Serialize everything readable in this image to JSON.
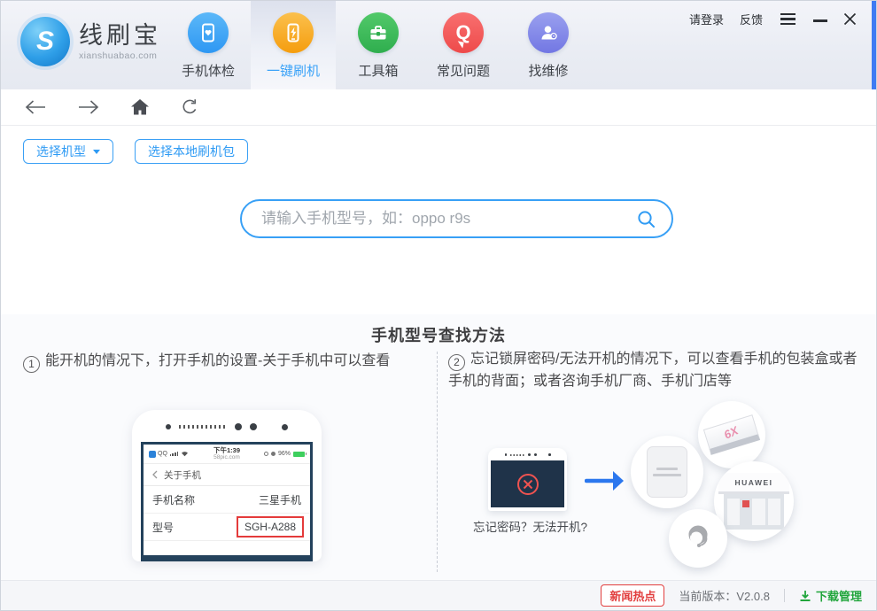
{
  "app": {
    "name": "线刷宝",
    "domain": "xianshuabao.com",
    "logo_letter": "S"
  },
  "header": {
    "login_label": "请登录",
    "feedback_label": "反馈",
    "nav": [
      {
        "label": "手机体检",
        "icon": "phone-checkup-icon",
        "color": "#2e97f3",
        "active": false
      },
      {
        "label": "一键刷机",
        "icon": "phone-flash-icon",
        "color": "#f59d0e",
        "active": true
      },
      {
        "label": "工具箱",
        "icon": "toolbox-icon",
        "color": "#2fae4e",
        "active": false
      },
      {
        "label": "常见问题",
        "icon": "faq-icon",
        "color": "#ee4a4a",
        "active": false,
        "glyph": "Q"
      },
      {
        "label": "找维修",
        "icon": "repair-icon",
        "color": "#7277e3",
        "active": false
      }
    ]
  },
  "actions": {
    "select_model": "选择机型",
    "select_local_package": "选择本地刷机包"
  },
  "search": {
    "placeholder": "请输入手机型号，如：oppo r9s"
  },
  "guide": {
    "title": "手机型号查找方法",
    "steps": [
      {
        "num": "1",
        "text": "能开机的情况下，打开手机的设置-关于手机中可以查看"
      },
      {
        "num": "2",
        "text": "忘记锁屏密码/无法开机的情况下，可以查看手机的包装盒或者手机的背面；或者咨询手机厂商、手机门店等"
      }
    ],
    "phone_demo": {
      "carrier": "QQ",
      "time": "下午1:39",
      "site": "58pic.com",
      "battery": "96%",
      "back_title": "关于手机",
      "rows": [
        {
          "label": "手机名称",
          "value": "三星手机"
        },
        {
          "label": "型号",
          "value": "SGH-A288"
        }
      ]
    },
    "locked_caption": "忘记密码？无法开机?",
    "package_box_label": "6X",
    "store_sign": "HUAWEI"
  },
  "footer": {
    "news": "新闻热点",
    "version": "当前版本：V2.0.8",
    "download": "下载管理"
  },
  "colors": {
    "accent_blue": "#2f9bf4",
    "badge_red": "#e23e3e",
    "download_green": "#21a53c",
    "screen_navy": "#1f3349",
    "battery_green": "#3ecf5e",
    "header_edge_blue": "#3f7bf3"
  }
}
